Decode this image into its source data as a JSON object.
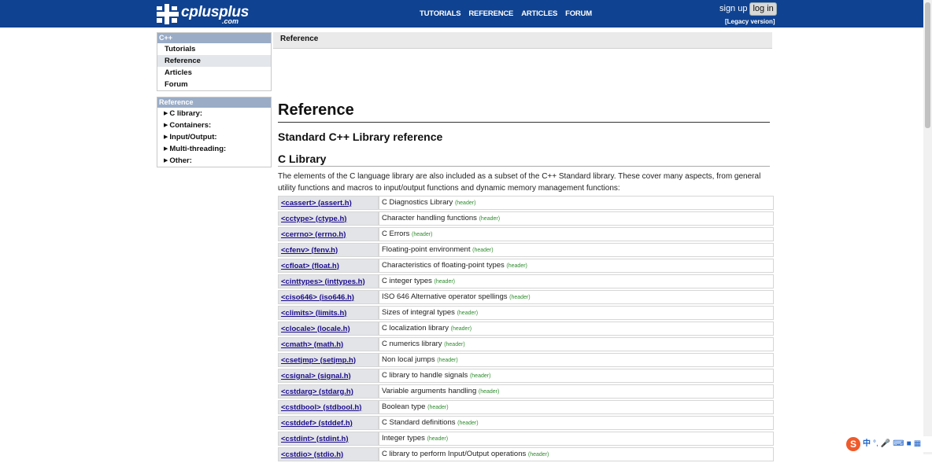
{
  "header": {
    "logo_text": "cplusplus",
    "logo_sub": ".com",
    "nav": [
      "TUTORIALS",
      "REFERENCE",
      "ARTICLES",
      "FORUM"
    ],
    "signup_label": "sign up",
    "login_label": "log in",
    "legacy_label": "[Legacy version]",
    "background_color": "#0f4290"
  },
  "sidebar": {
    "section1": {
      "title": "C++",
      "items": [
        "Tutorials",
        "Reference",
        "Articles",
        "Forum"
      ],
      "active_item": "Reference"
    },
    "section2": {
      "title": "Reference",
      "items": [
        "C library:",
        "Containers:",
        "Input/Output:",
        "Multi-threading:",
        "Other:"
      ]
    }
  },
  "breadcrumb": "Reference",
  "main": {
    "title": "Reference",
    "subtitle": "Standard C++ Library reference",
    "section_title": "C Library",
    "intro": "The elements of the C language library are also included as a subset of the C++ Standard library. These cover many aspects, from general utility functions and macros to input/output functions and dynamic memory management functions:",
    "tag_label": "(header)",
    "libraries": [
      {
        "name": "<cassert> (assert.h)",
        "desc": "C Diagnostics Library"
      },
      {
        "name": "<cctype> (ctype.h)",
        "desc": "Character handling functions"
      },
      {
        "name": "<cerrno> (errno.h)",
        "desc": "C Errors"
      },
      {
        "name": "<cfenv> (fenv.h)",
        "desc": "Floating-point environment"
      },
      {
        "name": "<cfloat> (float.h)",
        "desc": "Characteristics of floating-point types"
      },
      {
        "name": "<cinttypes> (inttypes.h)",
        "desc": "C integer types"
      },
      {
        "name": "<ciso646> (iso646.h)",
        "desc": "ISO 646 Alternative operator spellings"
      },
      {
        "name": "<climits> (limits.h)",
        "desc": "Sizes of integral types"
      },
      {
        "name": "<clocale> (locale.h)",
        "desc": "C localization library"
      },
      {
        "name": "<cmath> (math.h)",
        "desc": "C numerics library"
      },
      {
        "name": "<csetjmp> (setjmp.h)",
        "desc": "Non local jumps"
      },
      {
        "name": "<csignal> (signal.h)",
        "desc": "C library to handle signals"
      },
      {
        "name": "<cstdarg> (stdarg.h)",
        "desc": "Variable arguments handling"
      },
      {
        "name": "<cstdbool> (stdbool.h)",
        "desc": "Boolean type"
      },
      {
        "name": "<cstddef> (stddef.h)",
        "desc": "C Standard definitions"
      },
      {
        "name": "<cstdint> (stdint.h)",
        "desc": "Integer types"
      },
      {
        "name": "<cstdio> (stdio.h)",
        "desc": "C library to perform Input/Output operations"
      }
    ]
  },
  "ime_toolbar": {
    "logo": "S",
    "mode": "中",
    "icons": [
      "punctuation-icon",
      "microphone-icon",
      "keyboard-icon",
      "shirt-icon",
      "grid-icon"
    ]
  },
  "colors": {
    "link": "#1b0b8a",
    "tag": "#2e8b2e",
    "sidebar_head": "#9aacc6"
  }
}
